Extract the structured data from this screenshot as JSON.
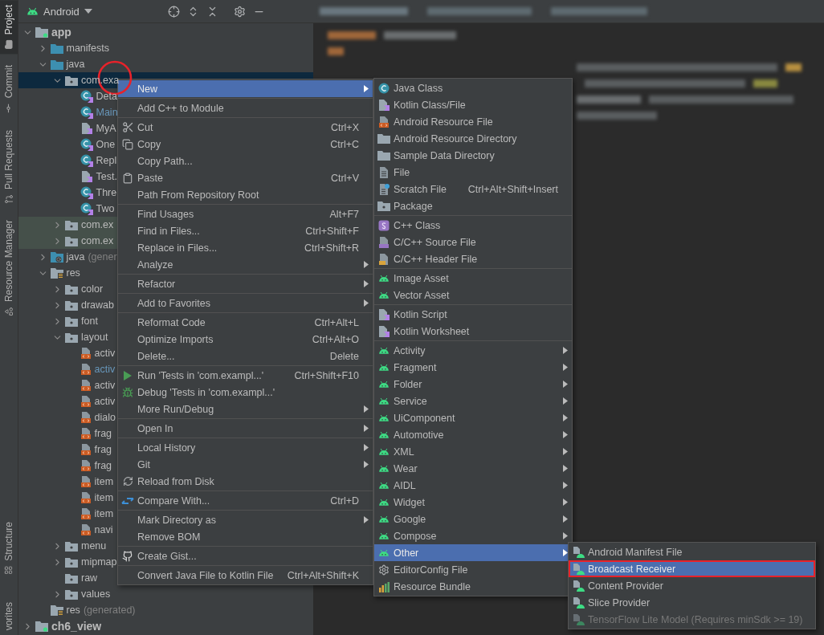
{
  "tool_strip": {
    "top": [
      {
        "label": "Project",
        "kind": "folder",
        "selected": true
      },
      {
        "label": "Commit",
        "kind": "commit",
        "selected": false
      },
      {
        "label": "Pull Requests",
        "kind": "pull",
        "selected": false
      },
      {
        "label": "Resource Manager",
        "kind": "shapes",
        "selected": false
      }
    ],
    "bottom": [
      {
        "label": "Structure",
        "kind": "grid",
        "selected": false
      },
      {
        "label": "vorites",
        "kind": "cut",
        "selected": false
      }
    ]
  },
  "project_panel": {
    "view": "Android",
    "tree": [
      {
        "label": "app",
        "kind": "module",
        "selected": false,
        "modified": false,
        "expanded": true,
        "children": [
          {
            "label": "manifests",
            "kind": "folder",
            "selected": false,
            "modified": false,
            "expanded": false
          },
          {
            "label": "java",
            "kind": "folder",
            "selected": false,
            "modified": false,
            "expanded": true,
            "children": [
              {
                "label": "com.exa",
                "kind": "package",
                "selected": true,
                "modified": false,
                "expanded": true,
                "children": [
                  {
                    "label": "Deta",
                    "kind": "kotlin-class",
                    "selected": false,
                    "modified": false
                  },
                  {
                    "label": "Main",
                    "kind": "kotlin-class",
                    "selected": false,
                    "modified": true
                  },
                  {
                    "label": "MyA",
                    "kind": "kotlin-file",
                    "selected": false,
                    "modified": false
                  },
                  {
                    "label": "One",
                    "kind": "kotlin-class",
                    "selected": false,
                    "modified": false
                  },
                  {
                    "label": "Repl",
                    "kind": "kotlin-class",
                    "selected": false,
                    "modified": false
                  },
                  {
                    "label": "Test.",
                    "kind": "kotlin-file",
                    "selected": false,
                    "modified": false
                  },
                  {
                    "label": "Thre",
                    "kind": "kotlin-class",
                    "selected": false,
                    "modified": false
                  },
                  {
                    "label": "Two",
                    "kind": "kotlin-class",
                    "selected": false,
                    "modified": false
                  }
                ]
              },
              {
                "label": "com.ex",
                "kind": "test-package",
                "selected": false,
                "modified": false,
                "expanded": false
              },
              {
                "label": "com.ex",
                "kind": "test-package",
                "selected": false,
                "modified": false,
                "expanded": false
              }
            ]
          },
          {
            "label": "java",
            "note": "(gener",
            "kind": "generated-folder",
            "selected": false,
            "modified": false,
            "expanded": false
          },
          {
            "label": "res",
            "kind": "res-folder",
            "selected": false,
            "modified": false,
            "expanded": true,
            "children": [
              {
                "label": "color",
                "kind": "package",
                "selected": false,
                "modified": false,
                "expanded": false
              },
              {
                "label": "drawab",
                "kind": "package",
                "selected": false,
                "modified": false,
                "expanded": false
              },
              {
                "label": "font",
                "kind": "package",
                "selected": false,
                "modified": false,
                "expanded": false
              },
              {
                "label": "layout",
                "kind": "package",
                "selected": false,
                "modified": false,
                "expanded": true,
                "children": [
                  {
                    "label": "activ",
                    "kind": "layout-file",
                    "selected": false,
                    "modified": false
                  },
                  {
                    "label": "activ",
                    "kind": "layout-file",
                    "selected": false,
                    "modified": true
                  },
                  {
                    "label": "activ",
                    "kind": "layout-file",
                    "selected": false,
                    "modified": false
                  },
                  {
                    "label": "activ",
                    "kind": "layout-file",
                    "selected": false,
                    "modified": false
                  },
                  {
                    "label": "dialo",
                    "kind": "layout-file",
                    "selected": false,
                    "modified": false
                  },
                  {
                    "label": "frag",
                    "kind": "layout-file",
                    "selected": false,
                    "modified": false
                  },
                  {
                    "label": "frag",
                    "kind": "layout-file",
                    "selected": false,
                    "modified": false
                  },
                  {
                    "label": "frag",
                    "kind": "layout-file",
                    "selected": false,
                    "modified": false
                  },
                  {
                    "label": "item",
                    "kind": "layout-file",
                    "selected": false,
                    "modified": false
                  },
                  {
                    "label": "item",
                    "kind": "layout-file",
                    "selected": false,
                    "modified": false
                  },
                  {
                    "label": "item",
                    "kind": "layout-file",
                    "selected": false,
                    "modified": false
                  },
                  {
                    "label": "navi",
                    "kind": "layout-file",
                    "selected": false,
                    "modified": false
                  }
                ]
              },
              {
                "label": "menu",
                "kind": "package",
                "selected": false,
                "modified": false,
                "expanded": false
              },
              {
                "label": "mipmap",
                "kind": "package",
                "selected": false,
                "modified": false,
                "expanded": false
              },
              {
                "label": "raw",
                "kind": "package",
                "selected": false,
                "modified": false
              },
              {
                "label": "values",
                "kind": "package",
                "selected": false,
                "modified": false,
                "expanded": false
              }
            ]
          },
          {
            "label": "res",
            "note": "(generated)",
            "kind": "generated-res",
            "selected": false,
            "modified": false
          }
        ]
      },
      {
        "label": "ch6_view",
        "kind": "module",
        "selected": false,
        "modified": false,
        "expanded": false
      }
    ]
  },
  "context_menu": {
    "groups": [
      [
        {
          "label": "New",
          "submenu": true,
          "selected": true
        }
      ],
      [
        {
          "label": "Add C++ to Module",
          "submenu": false,
          "selected": false
        }
      ],
      [
        {
          "label": "Cut",
          "shortcut": "Ctrl+X",
          "kind": "scissors",
          "submenu": false,
          "selected": false
        },
        {
          "label": "Copy",
          "shortcut": "Ctrl+C",
          "kind": "copy",
          "submenu": false,
          "selected": false
        },
        {
          "label": "Copy Path...",
          "submenu": false,
          "selected": false
        },
        {
          "label": "Paste",
          "shortcut": "Ctrl+V",
          "kind": "paste",
          "submenu": false,
          "selected": false
        },
        {
          "label": "Path From Repository Root",
          "submenu": false,
          "selected": false
        }
      ],
      [
        {
          "label": "Find Usages",
          "shortcut": "Alt+F7",
          "submenu": false,
          "selected": false
        },
        {
          "label": "Find in Files...",
          "shortcut": "Ctrl+Shift+F",
          "submenu": false,
          "selected": false
        },
        {
          "label": "Replace in Files...",
          "shortcut": "Ctrl+Shift+R",
          "submenu": false,
          "selected": false
        },
        {
          "label": "Analyze",
          "submenu": true,
          "selected": false
        }
      ],
      [
        {
          "label": "Refactor",
          "submenu": true,
          "selected": false
        }
      ],
      [
        {
          "label": "Add to Favorites",
          "submenu": true,
          "selected": false
        }
      ],
      [
        {
          "label": "Reformat Code",
          "shortcut": "Ctrl+Alt+L",
          "submenu": false,
          "selected": false
        },
        {
          "label": "Optimize Imports",
          "shortcut": "Ctrl+Alt+O",
          "submenu": false,
          "selected": false
        },
        {
          "label": "Delete...",
          "shortcut": "Delete",
          "submenu": false,
          "selected": false
        }
      ],
      [
        {
          "label": "Run 'Tests in 'com.exampl...'",
          "shortcut": "Ctrl+Shift+F10",
          "kind": "run",
          "submenu": false,
          "selected": false
        },
        {
          "label": "Debug 'Tests in 'com.exampl...'",
          "kind": "debug",
          "submenu": false,
          "selected": false
        },
        {
          "label": "More Run/Debug",
          "submenu": true,
          "selected": false
        }
      ],
      [
        {
          "label": "Open In",
          "submenu": true,
          "selected": false
        }
      ],
      [
        {
          "label": "Local History",
          "submenu": true,
          "selected": false
        },
        {
          "label": "Git",
          "submenu": true,
          "selected": false
        },
        {
          "label": "Reload from Disk",
          "kind": "reload",
          "submenu": false,
          "selected": false
        }
      ],
      [
        {
          "label": "Compare With...",
          "shortcut": "Ctrl+D",
          "kind": "compare",
          "submenu": false,
          "selected": false
        }
      ],
      [
        {
          "label": "Mark Directory as",
          "submenu": true,
          "selected": false
        },
        {
          "label": "Remove BOM",
          "submenu": false,
          "selected": false
        }
      ],
      [
        {
          "label": "Create Gist...",
          "kind": "github",
          "submenu": false,
          "selected": false
        }
      ],
      [
        {
          "label": "Convert Java File to Kotlin File",
          "shortcut": "Ctrl+Alt+Shift+K",
          "submenu": false,
          "selected": false
        }
      ]
    ]
  },
  "new_submenu": {
    "groups": [
      [
        {
          "label": "Java Class",
          "kind": "java-class",
          "submenu": false,
          "selected": false
        },
        {
          "label": "Kotlin Class/File",
          "kind": "kotlin-file",
          "submenu": false,
          "selected": false
        },
        {
          "label": "Android Resource File",
          "kind": "layout-file",
          "submenu": false,
          "selected": false
        },
        {
          "label": "Android Resource Directory",
          "kind": "plain-folder",
          "submenu": false,
          "selected": false
        },
        {
          "label": "Sample Data Directory",
          "kind": "plain-folder",
          "submenu": false,
          "selected": false
        },
        {
          "label": "File",
          "kind": "file",
          "submenu": false,
          "selected": false
        },
        {
          "label": "Scratch File",
          "shortcut": "Ctrl+Alt+Shift+Insert",
          "kind": "scratch",
          "submenu": false,
          "selected": false
        },
        {
          "label": "Package",
          "kind": "package",
          "submenu": false,
          "selected": false
        }
      ],
      [
        {
          "label": "C++ Class",
          "kind": "cpp-class",
          "submenu": false,
          "selected": false
        },
        {
          "label": "C/C++ Source File",
          "kind": "cpp-source",
          "submenu": false,
          "selected": false
        },
        {
          "label": "C/C++ Header File",
          "kind": "cpp-header",
          "submenu": false,
          "selected": false
        }
      ],
      [
        {
          "label": "Image Asset",
          "kind": "android",
          "submenu": false,
          "selected": false
        },
        {
          "label": "Vector Asset",
          "kind": "android",
          "submenu": false,
          "selected": false
        }
      ],
      [
        {
          "label": "Kotlin Script",
          "kind": "kotlin-script",
          "submenu": false,
          "selected": false
        },
        {
          "label": "Kotlin Worksheet",
          "kind": "kotlin-script",
          "submenu": false,
          "selected": false
        }
      ],
      [
        {
          "label": "Activity",
          "kind": "android",
          "submenu": true,
          "selected": false
        },
        {
          "label": "Fragment",
          "kind": "android",
          "submenu": true,
          "selected": false
        },
        {
          "label": "Folder",
          "kind": "android",
          "submenu": true,
          "selected": false
        },
        {
          "label": "Service",
          "kind": "android",
          "submenu": true,
          "selected": false
        },
        {
          "label": "UiComponent",
          "kind": "android",
          "submenu": true,
          "selected": false
        },
        {
          "label": "Automotive",
          "kind": "android",
          "submenu": true,
          "selected": false
        },
        {
          "label": "XML",
          "kind": "android",
          "submenu": true,
          "selected": false
        },
        {
          "label": "Wear",
          "kind": "android",
          "submenu": true,
          "selected": false
        },
        {
          "label": "AIDL",
          "kind": "android",
          "submenu": true,
          "selected": false
        },
        {
          "label": "Widget",
          "kind": "android",
          "submenu": true,
          "selected": false
        },
        {
          "label": "Google",
          "kind": "android",
          "submenu": true,
          "selected": false
        },
        {
          "label": "Compose",
          "kind": "android",
          "submenu": true,
          "selected": false
        },
        {
          "label": "Other",
          "kind": "android",
          "submenu": true,
          "selected": true
        },
        {
          "label": "EditorConfig File",
          "kind": "gear",
          "submenu": false,
          "selected": false
        },
        {
          "label": "Resource Bundle",
          "kind": "bundle",
          "submenu": false,
          "selected": false
        }
      ]
    ]
  },
  "other_submenu": {
    "groups": [
      [
        {
          "label": "Android Manifest File",
          "kind": "manifest",
          "submenu": false,
          "selected": false,
          "outlined": false,
          "disabled": false
        },
        {
          "label": "Broadcast Receiver",
          "kind": "manifest",
          "submenu": false,
          "selected": true,
          "outlined": true,
          "disabled": false
        },
        {
          "label": "Content Provider",
          "kind": "manifest",
          "submenu": false,
          "selected": false,
          "outlined": false,
          "disabled": false
        },
        {
          "label": "Slice Provider",
          "kind": "manifest",
          "submenu": false,
          "selected": false,
          "outlined": false,
          "disabled": false
        },
        {
          "label": "TensorFlow Lite Model (Requires minSdk >= 19)",
          "kind": "manifest",
          "submenu": false,
          "selected": false,
          "outlined": false,
          "disabled": true
        }
      ]
    ]
  }
}
